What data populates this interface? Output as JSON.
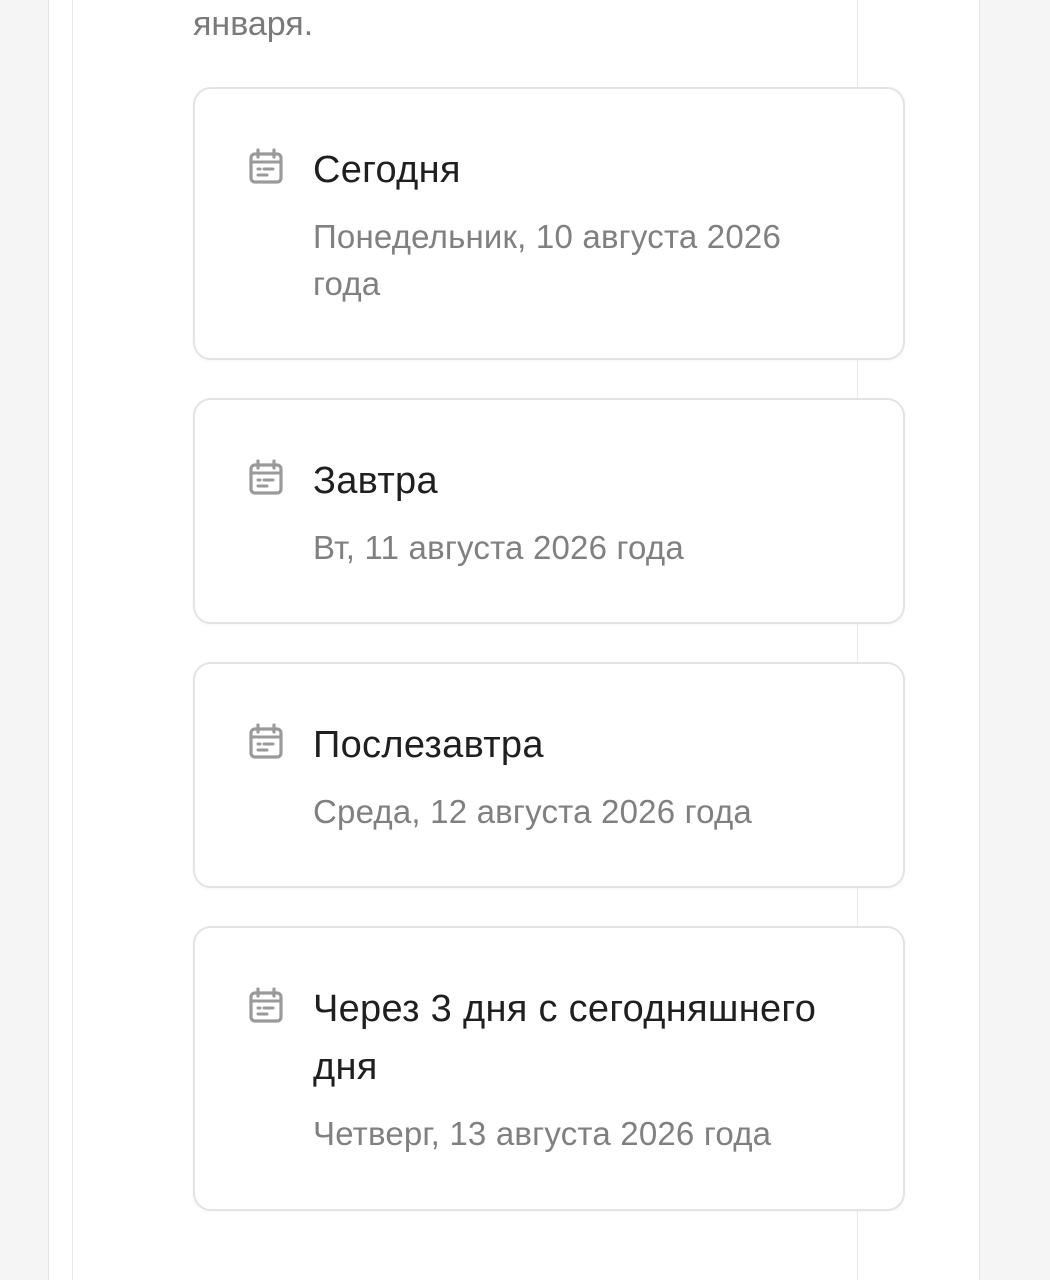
{
  "intro": {
    "tail_text": "января."
  },
  "cards": [
    {
      "icon": "calendar-icon",
      "title": "Сегодня",
      "date": "Понедельник, 10 августа 2026 года"
    },
    {
      "icon": "calendar-icon",
      "title": "Завтра",
      "date": "Вт, 11 августа 2026 года"
    },
    {
      "icon": "calendar-icon",
      "title": "Послезавтра",
      "date": "Среда, 12 августа 2026 года"
    },
    {
      "icon": "calendar-icon",
      "title": "Через 3 дня с сегодняшнего дня",
      "date": "Четверг, 13 августа 2026 года"
    }
  ],
  "colors": {
    "title_text": "#1f1f1f",
    "secondary_text": "#808080",
    "card_border": "#e3e3e3",
    "icon_gray": "#9a9a9a"
  }
}
